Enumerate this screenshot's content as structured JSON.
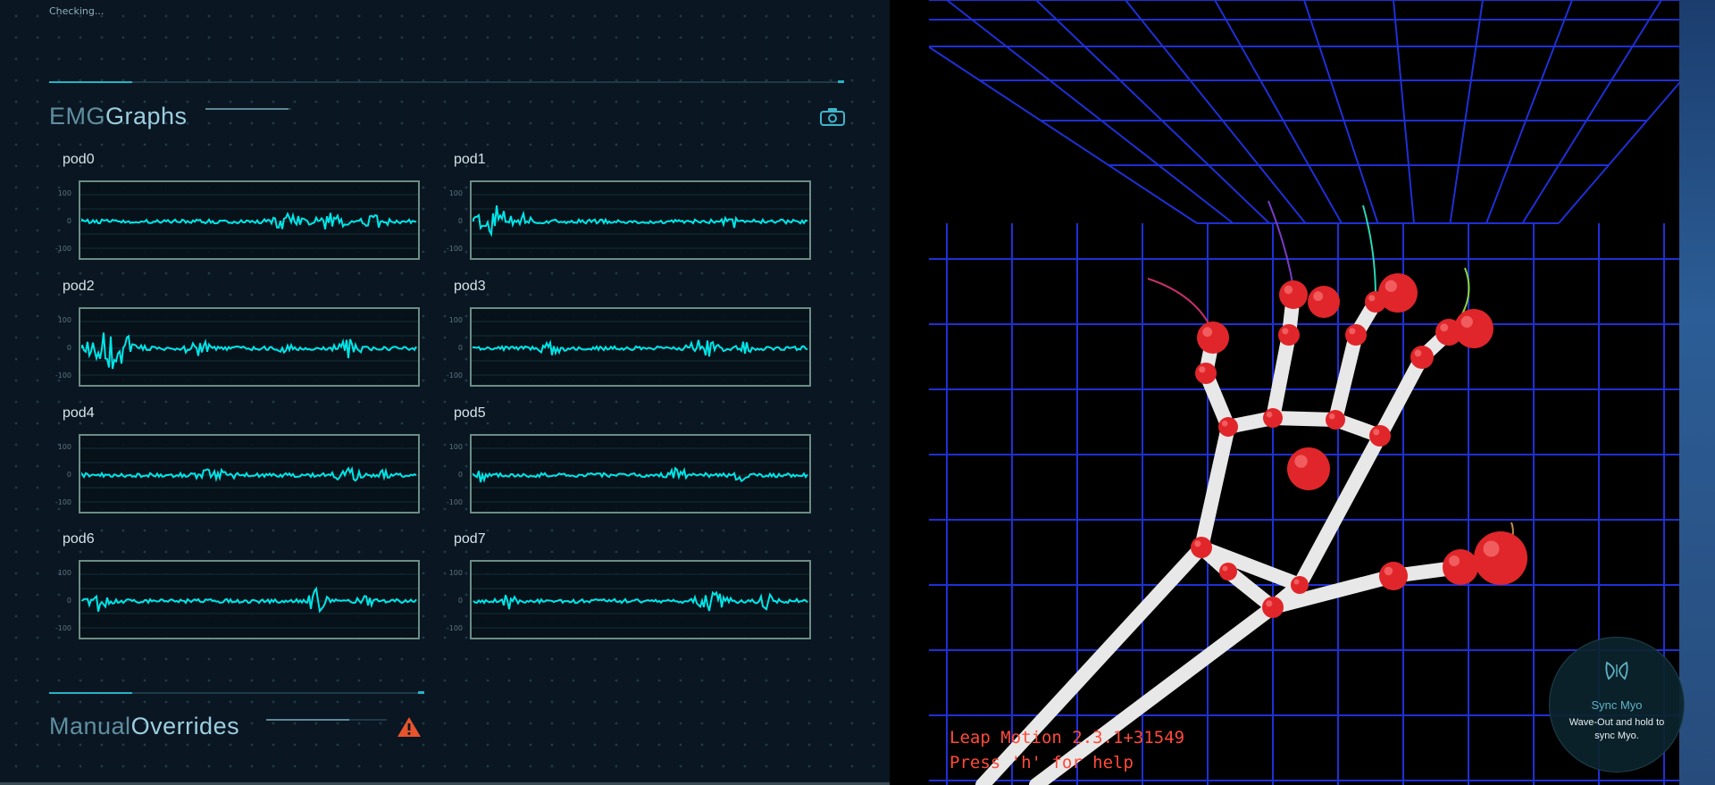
{
  "status": {
    "text": "Checking..."
  },
  "emg": {
    "title_part1": "EMG",
    "title_part2": "Graphs",
    "icon": "camera-icon",
    "accent_color": "#00e5e8",
    "pods": [
      {
        "label": "pod0",
        "ticks": [
          "100",
          "0",
          "-100"
        ]
      },
      {
        "label": "pod1",
        "ticks": [
          "100",
          "0",
          "-100"
        ]
      },
      {
        "label": "pod2",
        "ticks": [
          "100",
          "0",
          "-100"
        ]
      },
      {
        "label": "pod3",
        "ticks": [
          "100",
          "0",
          "-100"
        ]
      },
      {
        "label": "pod4",
        "ticks": [
          "100",
          "0",
          "-100"
        ]
      },
      {
        "label": "pod5",
        "ticks": [
          "100",
          "0",
          "-100"
        ]
      },
      {
        "label": "pod6",
        "ticks": [
          "100",
          "0",
          "-100"
        ]
      },
      {
        "label": "pod7",
        "ticks": [
          "100",
          "0",
          "-100"
        ]
      }
    ]
  },
  "overrides": {
    "title_part1": "Manual",
    "title_part2": "Overrides",
    "icon": "warning-icon",
    "warning_color": "#e8542c"
  },
  "leap": {
    "version_line": "Leap Motion 2.3.1+31549",
    "help_line": "Press 'h' for help",
    "grid_color": "#1f2fd6",
    "joint_color": "#e0262a"
  },
  "sync": {
    "title": "Sync Myo",
    "description": "Wave-Out and hold to sync Myo.",
    "icon": "myo-armband-icon"
  }
}
